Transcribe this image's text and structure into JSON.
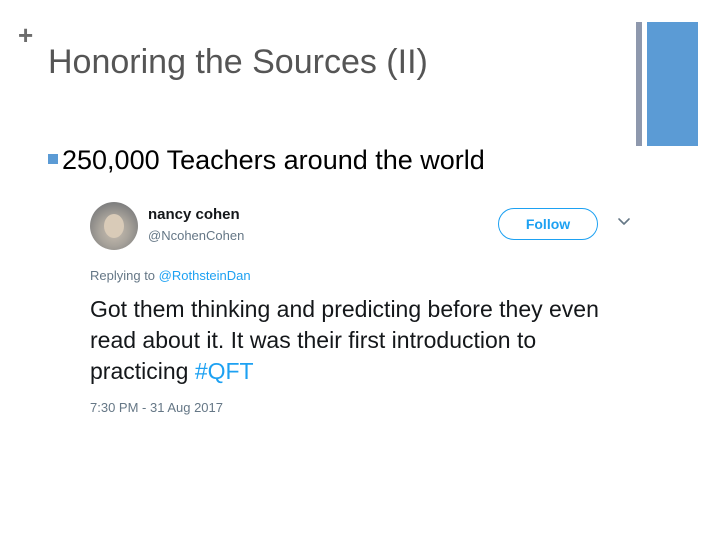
{
  "slide": {
    "plus": "+",
    "title": "Honoring the Sources (II)",
    "bullet": "250,000 Teachers around the world"
  },
  "tweet": {
    "name": "nancy cohen",
    "handle": "@NcohenCohen",
    "follow_label": "Follow",
    "replying_prefix": "Replying to ",
    "replying_to": "@RothsteinDan",
    "text": "Got them thinking and predicting before they even read about it. It was their first introduction to practicing ",
    "hashtag": "#QFT",
    "timestamp": "7:30 PM - 31 Aug 2017"
  },
  "colors": {
    "accent": "#5b9bd5",
    "accent_dark": "#8e98ad",
    "twitter_blue": "#1da1f2"
  },
  "icons": {
    "chevron": "chevron-down-icon",
    "avatar": "avatar"
  }
}
